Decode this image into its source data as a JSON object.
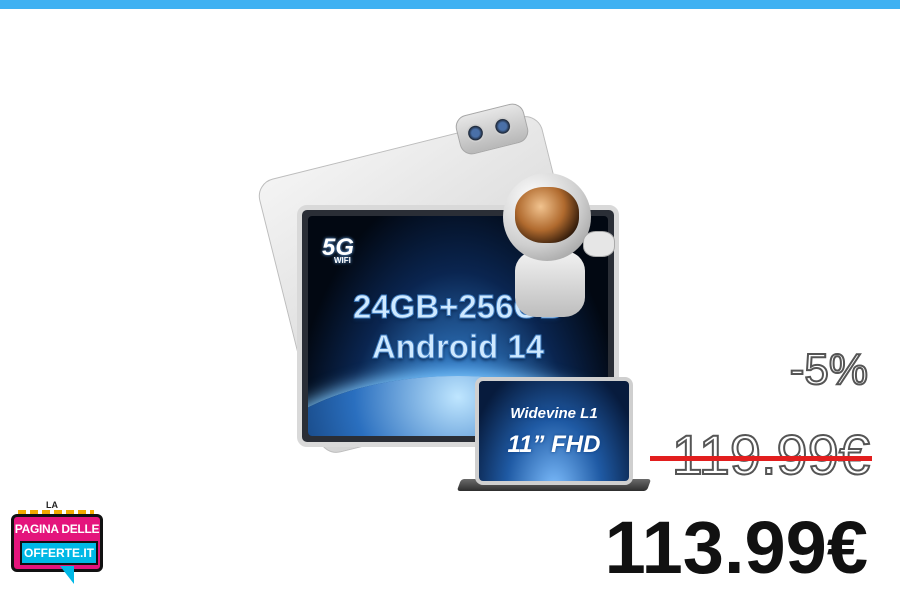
{
  "product": {
    "screen_network": "5G",
    "screen_wifi": "WIFI",
    "screen_spec_line1": "24GB+256GB",
    "screen_spec_line2": "Android 14",
    "small_screen_line1": "Widevine L1",
    "small_screen_line2": "11” FHD"
  },
  "pricing": {
    "discount": "-5%",
    "old_price": "119.99€",
    "new_price": "113.99€"
  },
  "logo": {
    "top": "LA",
    "line1": "PAGINA DELLE",
    "line2": "OFFERTE.IT"
  },
  "colors": {
    "top_bar": "#3fb1f2",
    "strike": "#e21e1e",
    "logo_pink": "#e4147c",
    "logo_cyan": "#00b8e6"
  }
}
